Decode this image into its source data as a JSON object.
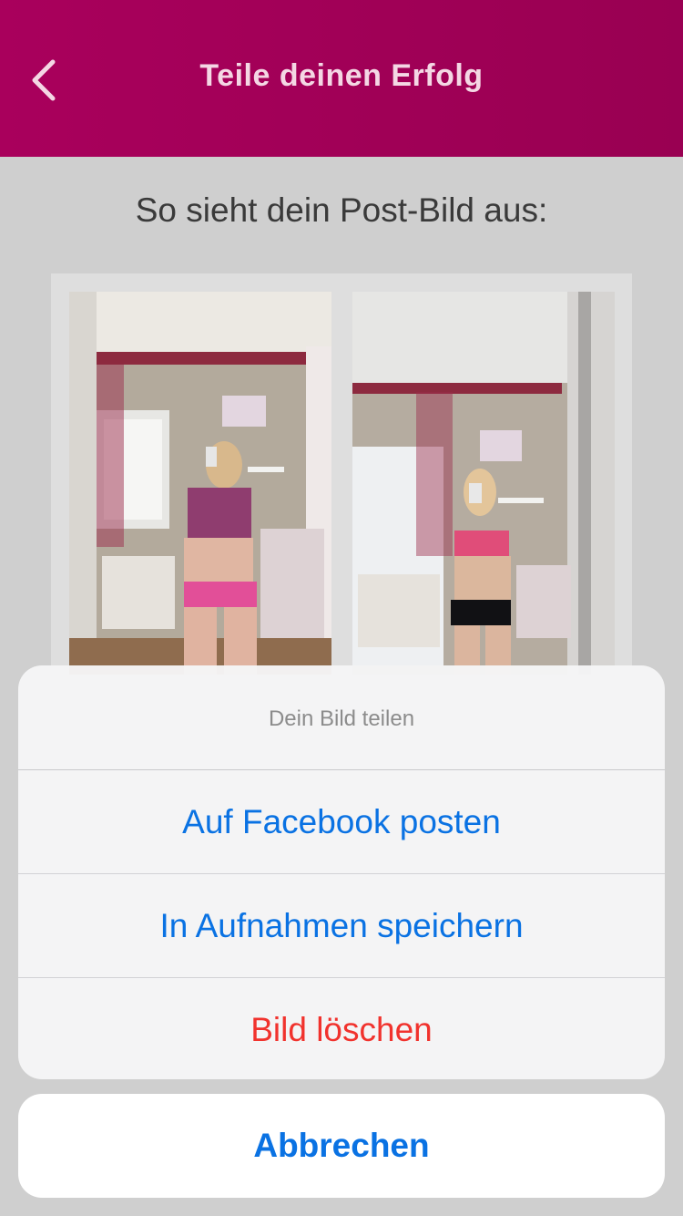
{
  "header": {
    "title": "Teile deinen Erfolg",
    "back_icon": "chevron-left-icon"
  },
  "main": {
    "subtitle": "So sieht dein Post-Bild aus:"
  },
  "action_sheet": {
    "title": "Dein Bild teilen",
    "actions": [
      {
        "label": "Auf Facebook posten"
      },
      {
        "label": "In Aufnahmen speichern"
      },
      {
        "label": "Bild löschen"
      }
    ],
    "cancel_label": "Abbrechen"
  },
  "colors": {
    "header_background": "#a3005a",
    "action_blue": "#0a72e3",
    "destructive_red": "#f1322d"
  }
}
